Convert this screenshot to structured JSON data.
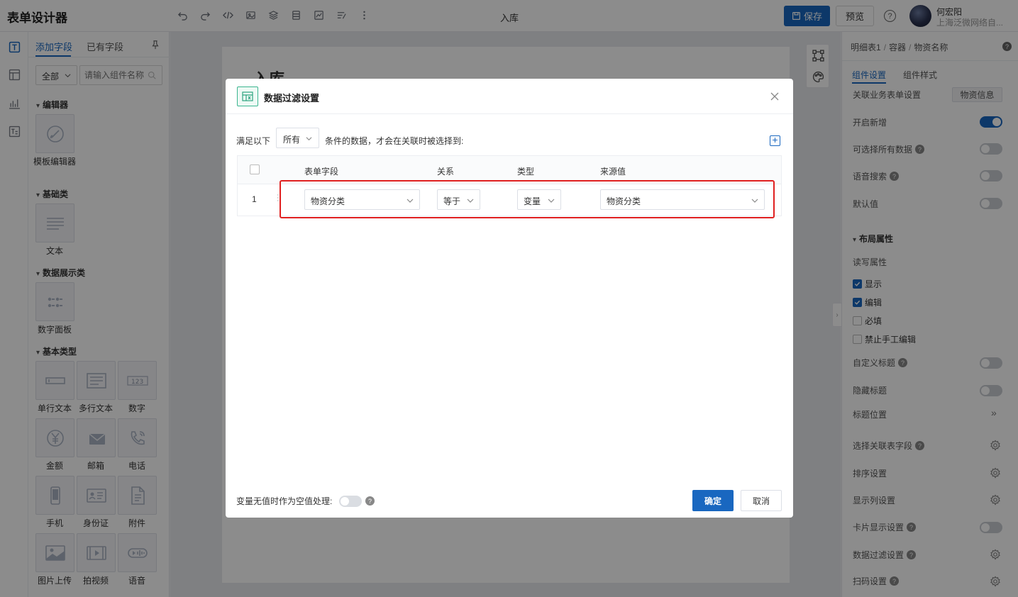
{
  "app": {
    "title": "表单设计器",
    "form_name": "入库"
  },
  "header": {
    "save_label": "保存",
    "preview_label": "预览",
    "help_glyph": "?",
    "user_name": "何宏阳",
    "user_org": "上海泛微网络自..."
  },
  "components": {
    "tabs": [
      "添加字段",
      "已有字段"
    ],
    "category": "全部",
    "search_placeholder": "请输入组件名称",
    "groups": {
      "editor": "编辑器",
      "basic": "基础类",
      "display": "数据展示类",
      "types": "基本类型"
    },
    "items": {
      "template_editor": "模板编辑器",
      "text": "文本",
      "number_panel": "数字面板",
      "single_line": "单行文本",
      "multi_line": "多行文本",
      "number": "数字",
      "amount": "金额",
      "email": "邮箱",
      "phone": "电话",
      "mobile": "手机",
      "id_card": "身份证",
      "attachment": "附件",
      "image_upload": "图片上传",
      "video": "拍视频",
      "voice": "语音"
    }
  },
  "canvas": {
    "heading": "入库"
  },
  "props": {
    "breadcrumb": [
      "明细表1",
      "容器",
      "物资名称"
    ],
    "tabs": [
      "组件设置",
      "组件样式"
    ],
    "biz_form_label": "关联业务表单设置",
    "biz_form_button": "物资信息",
    "enable_add": "开启新增",
    "select_all": "可选择所有数据",
    "voice_search": "语音搜索",
    "default_value": "默认值",
    "layout_section": "布局属性",
    "rw_label": "读写属性",
    "checkbox_show": "显示",
    "checkbox_edit": "编辑",
    "checkbox_required": "必填",
    "checkbox_no_manual": "禁止手工编辑",
    "custom_title": "自定义标题",
    "hide_title": "隐藏标题",
    "title_position": "标题位置",
    "select_fields": "选择关联表字段",
    "sort_settings": "排序设置",
    "display_columns": "显示列设置",
    "card_display": "卡片显示设置",
    "data_filter": "数据过滤设置",
    "scan_settings": "扫码设置"
  },
  "modal": {
    "title": "数据过滤设置",
    "condition_prefix": "满足以下",
    "condition_mode": "所有",
    "condition_suffix": "条件的数据，才会在关联时被选择到:",
    "add_glyph": "+",
    "columns": [
      "表单字段",
      "关系",
      "类型",
      "来源值"
    ],
    "rows": [
      {
        "index": "1",
        "field": "物资分类",
        "relation": "等于",
        "type": "变量",
        "source": "物资分类"
      }
    ],
    "null_label": "变量无值时作为空值处理:",
    "ok_label": "确定",
    "cancel_label": "取消"
  },
  "colors": {
    "primary": "#1967c0",
    "highlight": "#e02020",
    "modal_icon": "#2da37f"
  }
}
